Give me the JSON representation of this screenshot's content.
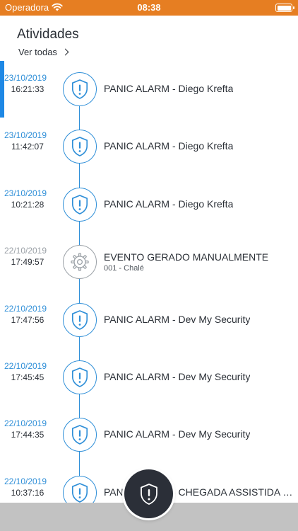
{
  "status_bar": {
    "carrier": "Operadora",
    "time": "08:38",
    "wifi_icon": "wifi-icon",
    "battery_icon": "battery-icon"
  },
  "header": {
    "title": "Atividades",
    "see_all": "Ver todas"
  },
  "activities": [
    {
      "date": "23/10/2019",
      "time": "16:21:33",
      "event": "PANIC ALARM  - Diego Krefta",
      "sub": "",
      "icon": "shield-alert-icon",
      "color": "#2f8fd8",
      "selected": true
    },
    {
      "date": "23/10/2019",
      "time": "11:42:07",
      "event": "PANIC ALARM  - Diego Krefta",
      "sub": "",
      "icon": "shield-alert-icon",
      "color": "#2f8fd8",
      "selected": false
    },
    {
      "date": "23/10/2019",
      "time": "10:21:28",
      "event": "PANIC ALARM  - Diego Krefta",
      "sub": "",
      "icon": "shield-alert-icon",
      "color": "#2f8fd8",
      "selected": false
    },
    {
      "date": "22/10/2019",
      "time": "17:49:57",
      "event": "EVENTO GERADO MANUALMENTE",
      "sub": "001 - Chalé",
      "icon": "gear-icon",
      "color": "#9aa0a6",
      "selected": false
    },
    {
      "date": "22/10/2019",
      "time": "17:47:56",
      "event": "PANIC ALARM  - Dev My Security",
      "sub": "",
      "icon": "shield-alert-icon",
      "color": "#2f8fd8",
      "selected": false
    },
    {
      "date": "22/10/2019",
      "time": "17:45:45",
      "event": "PANIC ALARM  - Dev My Security",
      "sub": "",
      "icon": "shield-alert-icon",
      "color": "#2f8fd8",
      "selected": false
    },
    {
      "date": "22/10/2019",
      "time": "17:44:35",
      "event": "PANIC ALARM  - Dev My Security",
      "sub": "",
      "icon": "shield-alert-icon",
      "color": "#2f8fd8",
      "selected": false
    },
    {
      "date": "22/10/2019",
      "time": "10:37:16",
      "event": "PANIC ALARM  - CHEGADA ASSISTIDA - Dev My Security",
      "sub": "",
      "icon": "shield-alert-icon",
      "color": "#2f8fd8",
      "selected": false
    }
  ],
  "fab": {
    "icon": "shield-alert-icon"
  }
}
